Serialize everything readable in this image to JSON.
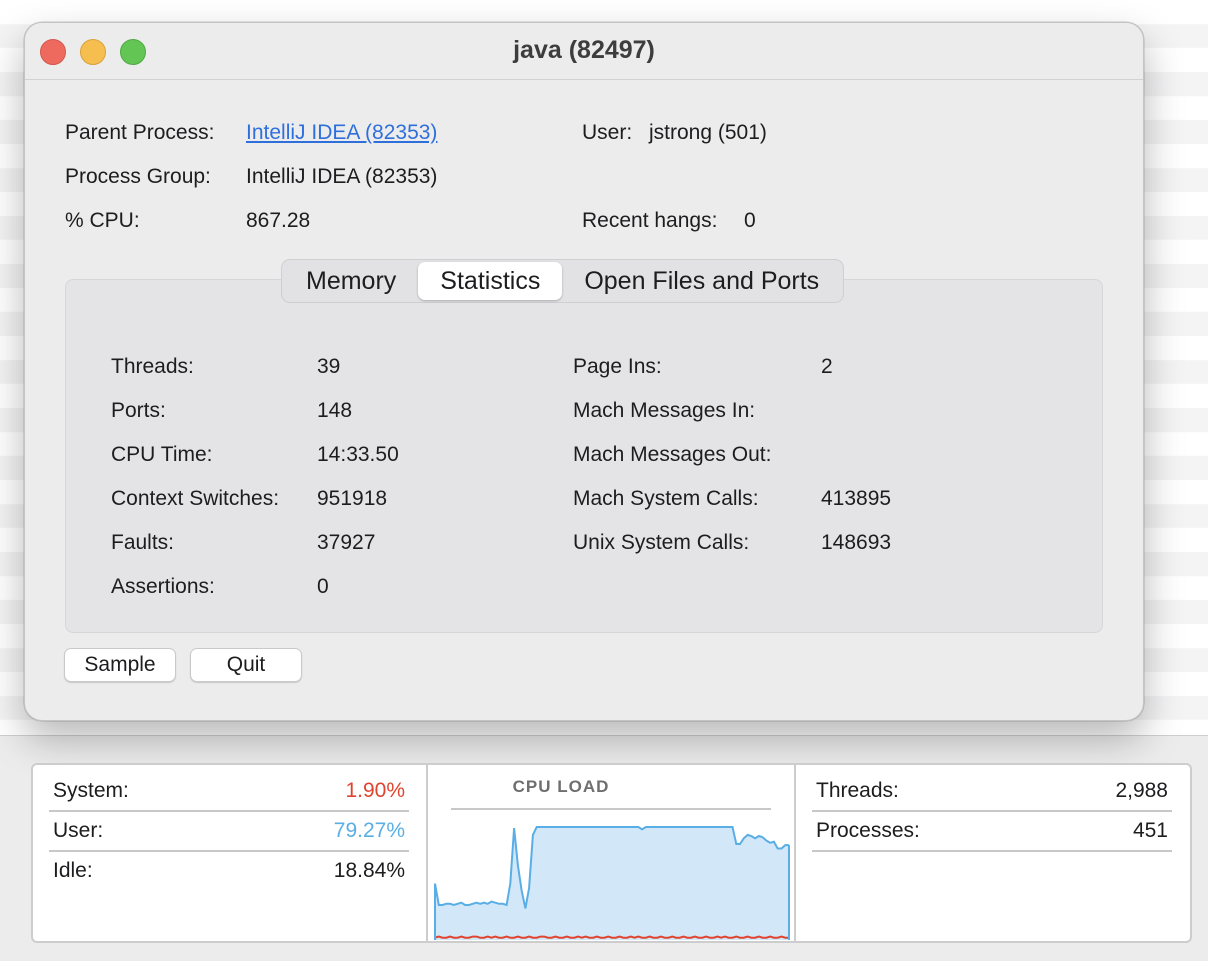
{
  "window": {
    "title": "java (82497)",
    "info": {
      "parent_process_label": "Parent Process:",
      "parent_process_value": "IntelliJ IDEA (82353)",
      "user_label": "User:",
      "user_value": "jstrong (501)",
      "process_group_label": "Process Group:",
      "process_group_value": "IntelliJ IDEA (82353)",
      "cpu_label": "% CPU:",
      "cpu_value": "867.28",
      "recent_hangs_label": "Recent hangs:",
      "recent_hangs_value": "0"
    },
    "tabs": [
      {
        "label": "Memory",
        "selected": false
      },
      {
        "label": "Statistics",
        "selected": true
      },
      {
        "label": "Open Files and Ports",
        "selected": false
      }
    ],
    "stats_left": [
      {
        "label": "Threads:",
        "value": "39"
      },
      {
        "label": "Ports:",
        "value": "148"
      },
      {
        "label": "CPU Time:",
        "value": "14:33.50"
      },
      {
        "label": "Context Switches:",
        "value": "951918"
      },
      {
        "label": "Faults:",
        "value": "37927"
      },
      {
        "label": "Assertions:",
        "value": "0"
      }
    ],
    "stats_right": [
      {
        "label": "Page Ins:",
        "value": "2"
      },
      {
        "label": "Mach Messages In:",
        "value": ""
      },
      {
        "label": "Mach Messages Out:",
        "value": ""
      },
      {
        "label": "Mach System Calls:",
        "value": "413895"
      },
      {
        "label": "Unix System Calls:",
        "value": "148693"
      }
    ],
    "buttons": {
      "sample": "Sample",
      "quit": "Quit"
    }
  },
  "cpu_panel": {
    "system_label": "System:",
    "system_value": "1.90%",
    "user_label": "User:",
    "user_value": "79.27%",
    "idle_label": "Idle:",
    "idle_value": "18.84%",
    "chart_title": "CPU LOAD",
    "threads_label": "Threads:",
    "threads_value": "2,988",
    "processes_label": "Processes:",
    "processes_value": "451",
    "colors": {
      "system": "#e0442f",
      "user": "#5aaee6",
      "user_fill": "#d2e8f8"
    }
  },
  "chart_data": {
    "type": "area",
    "title": "CPU LOAD",
    "ylim": [
      0,
      100
    ],
    "series": [
      {
        "name": "User",
        "values": [
          50,
          31,
          31,
          32,
          32,
          31,
          32,
          33,
          31,
          31,
          32,
          33,
          32,
          33,
          32,
          34,
          33,
          32,
          32,
          31,
          50,
          99,
          66,
          44,
          28,
          46,
          93,
          100,
          100,
          100,
          100,
          100,
          100,
          100,
          100,
          100,
          100,
          100,
          100,
          100,
          100,
          100,
          100,
          100,
          100,
          100,
          100,
          100,
          100,
          100,
          100,
          100,
          100,
          100,
          100,
          98,
          100,
          100,
          100,
          100,
          100,
          100,
          100,
          100,
          100,
          100,
          100,
          100,
          100,
          100,
          100,
          100,
          100,
          100,
          100,
          100,
          100,
          100,
          100,
          100,
          85,
          85,
          90,
          93,
          92,
          90,
          92,
          91,
          88,
          86,
          87,
          81,
          81,
          84,
          84
        ]
      },
      {
        "name": "System",
        "values": [
          2,
          3,
          2,
          2,
          3,
          2,
          2,
          3,
          2,
          2,
          3,
          3,
          2,
          2,
          3,
          2,
          3,
          2,
          2,
          3,
          2,
          2,
          3,
          2,
          2,
          3,
          2,
          2,
          3,
          3,
          2,
          2,
          3,
          2,
          2,
          3,
          2,
          2,
          3,
          2,
          3,
          2,
          2,
          3,
          2,
          2,
          3,
          2,
          2,
          3,
          2,
          2,
          3,
          2,
          3,
          2,
          2,
          3,
          2,
          2,
          3,
          2,
          2,
          3,
          2,
          2,
          3,
          2,
          2,
          3,
          2,
          2,
          3,
          2,
          2,
          3,
          2,
          3,
          2,
          2,
          3,
          2,
          2,
          3,
          2,
          2,
          3,
          2,
          2,
          3,
          2,
          2,
          3,
          2,
          2
        ]
      }
    ]
  }
}
